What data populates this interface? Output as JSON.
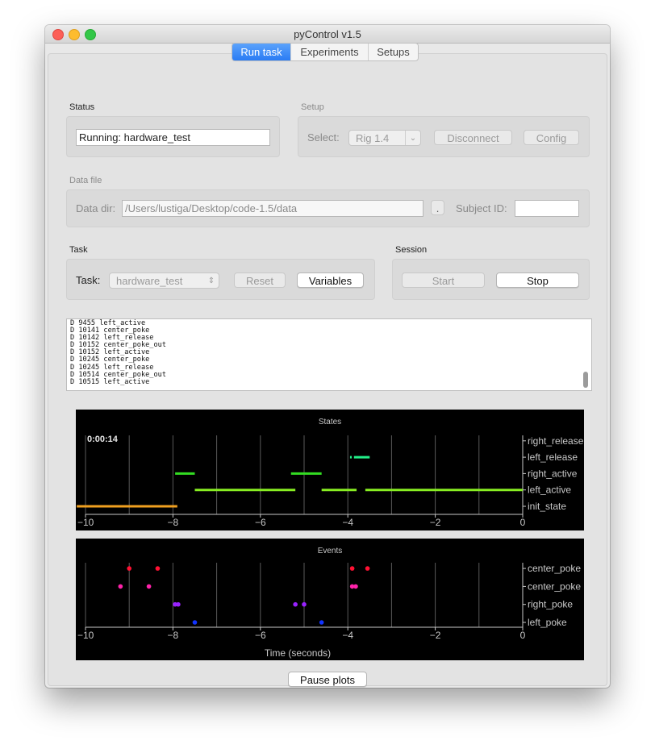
{
  "window": {
    "title": "pyControl v1.5"
  },
  "tabs": [
    "Run task",
    "Experiments",
    "Setups"
  ],
  "status": {
    "title": "Status",
    "value": "Running: hardware_test"
  },
  "setup": {
    "title": "Setup",
    "select_label": "Select:",
    "select_value": "Rig 1.4",
    "disconnect": "Disconnect",
    "config": "Config"
  },
  "data_file": {
    "title": "Data file",
    "dir_label": "Data dir:",
    "dir_value": "/Users/lustiga/Desktop/code-1.5/data",
    "browse": ".",
    "subject_label": "Subject ID:",
    "subject_value": ""
  },
  "task": {
    "title": "Task",
    "label": "Task:",
    "value": "hardware_test",
    "reset": "Reset",
    "variables": "Variables"
  },
  "session": {
    "title": "Session",
    "start": "Start",
    "stop": "Stop"
  },
  "log": [
    "D 9455 left_active",
    "D 10141 center_poke",
    "D 10142 left_release",
    "D 10152 center_poke_out",
    "D 10152 left_active",
    "D 10245 center_poke",
    "D 10245 left_release",
    "D 10514 center_poke_out",
    "D 10515 left_active"
  ],
  "states_plot": {
    "title": "States",
    "elapsed": "0:00:14",
    "xlim": [
      -10,
      0
    ],
    "x_ticks": [
      -10,
      -8,
      -6,
      -4,
      -2,
      0
    ],
    "categories": [
      "init_state",
      "left_active",
      "right_active",
      "left_release",
      "right_release"
    ],
    "segments": [
      {
        "state": "init_state",
        "start": -10.2,
        "end": -7.9,
        "color": "#f0a020"
      },
      {
        "state": "right_active",
        "start": -7.95,
        "end": -7.5,
        "color": "#33dd22"
      },
      {
        "state": "left_active",
        "start": -7.5,
        "end": -5.2,
        "color": "#88ee22"
      },
      {
        "state": "right_active",
        "start": -5.3,
        "end": -4.6,
        "color": "#33dd22"
      },
      {
        "state": "left_active",
        "start": -4.6,
        "end": -3.8,
        "color": "#88ee22"
      },
      {
        "state": "left_release",
        "start": -3.95,
        "end": -3.91,
        "color": "#22ee88"
      },
      {
        "state": "left_release",
        "start": -3.86,
        "end": -3.5,
        "color": "#22ee88"
      },
      {
        "state": "left_active",
        "start": -3.6,
        "end": 0,
        "color": "#88ee22"
      }
    ]
  },
  "events_plot": {
    "title": "Events",
    "xlabel": "Time (seconds)",
    "xlim": [
      -10,
      0
    ],
    "x_ticks": [
      -10,
      -8,
      -6,
      -4,
      -2,
      0
    ],
    "categories": [
      "left_poke",
      "right_poke",
      "center_poke",
      "center_poke"
    ],
    "points": [
      {
        "event": 3,
        "t": -9.0,
        "color": "#ff1133"
      },
      {
        "event": 3,
        "t": -8.35,
        "color": "#ff1133"
      },
      {
        "event": 3,
        "t": -3.9,
        "color": "#ff1133"
      },
      {
        "event": 3,
        "t": -3.55,
        "color": "#ff1133"
      },
      {
        "event": 2,
        "t": -9.2,
        "color": "#ff22aa"
      },
      {
        "event": 2,
        "t": -8.55,
        "color": "#ff22aa"
      },
      {
        "event": 2,
        "t": -3.9,
        "color": "#ff22aa"
      },
      {
        "event": 2,
        "t": -3.82,
        "color": "#ff22aa"
      },
      {
        "event": 1,
        "t": -7.95,
        "color": "#9922ff"
      },
      {
        "event": 1,
        "t": -7.88,
        "color": "#9922ff"
      },
      {
        "event": 1,
        "t": -5.2,
        "color": "#9922ff"
      },
      {
        "event": 1,
        "t": -5.0,
        "color": "#9922ff"
      },
      {
        "event": 0,
        "t": -7.5,
        "color": "#1133ff"
      },
      {
        "event": 0,
        "t": -4.6,
        "color": "#1133ff"
      }
    ]
  },
  "pause_button": "Pause plots"
}
